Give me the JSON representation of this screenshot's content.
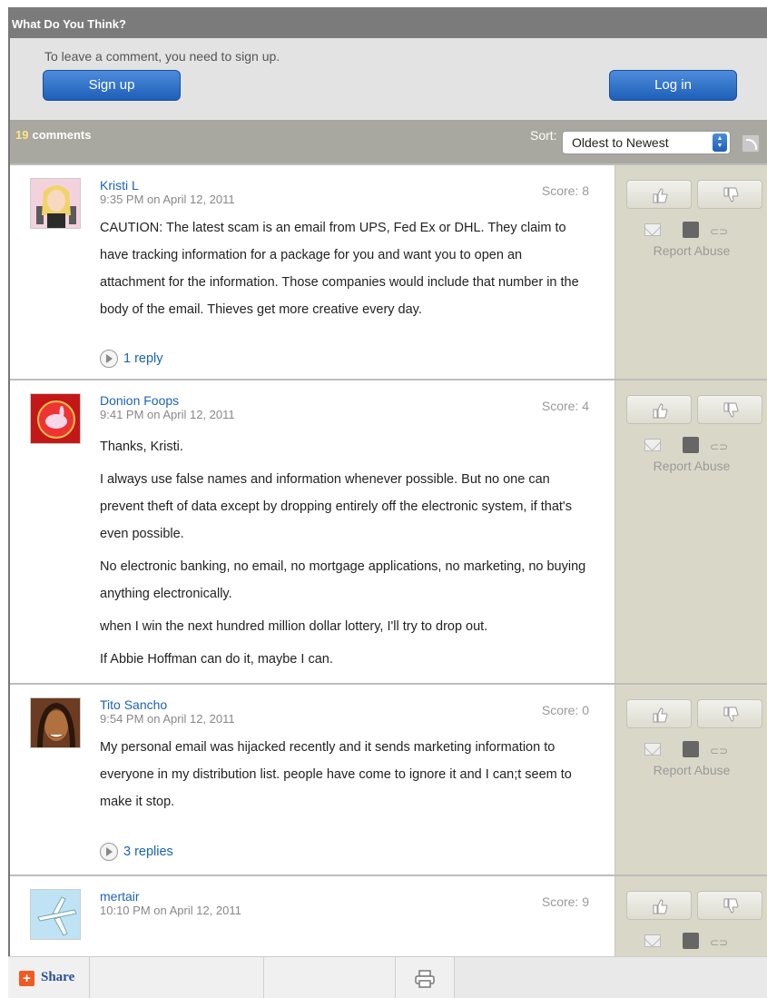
{
  "header": {
    "title": "What Do You Think?"
  },
  "signup": {
    "prompt": "To leave a comment, you need to sign up.",
    "signup_label": "Sign up",
    "login_label": "Log in"
  },
  "comments_bar": {
    "count": "19",
    "count_label": "comments",
    "sort_label": "Sort:",
    "sort_value": "Oldest to Newest"
  },
  "comments": [
    {
      "author": "Kristi L",
      "time": "9:35 PM on April 12, 2011",
      "score": "Score: 8",
      "paragraphs": [
        "CAUTION: The latest scam is an email from UPS, Fed Ex or DHL. They claim to have tracking information for a package for you and want you to open an attachment for the information. Those companies would include that number in the body of the email. Thieves get more creative every day."
      ],
      "replies": "1 reply"
    },
    {
      "author": "Donion Foops",
      "time": "9:41 PM on April 12, 2011",
      "score": "Score: 4",
      "paragraphs": [
        "Thanks, Kristi.",
        "I always use false names and information whenever possible. But no one can prevent theft of data except by dropping entirely off the electronic system, if that's even possible.",
        "No electronic banking, no email, no mortgage applications, no marketing, no buying anything electronically.",
        "when I win the next hundred million dollar lottery, I'll try to drop out.",
        "If Abbie Hoffman can do it, maybe I can."
      ]
    },
    {
      "author": "Tito Sancho",
      "time": "9:54 PM on April 12, 2011",
      "score": "Score: 0",
      "paragraphs": [
        "My personal email was hijacked recently and it sends marketing information to everyone in my distribution list. people have come to ignore it and I can;t seem to make it stop."
      ],
      "replies": "3 replies"
    },
    {
      "author": "mertair",
      "time": "10:10 PM on April 12, 2011",
      "score": "Score: 9"
    }
  ],
  "side": {
    "report_label": "Report Abuse"
  },
  "share_bar": {
    "share_label": "Share"
  },
  "colors": {
    "accent_blue": "#1a63b7",
    "count_yellow": "#ffe680",
    "share_orange": "#f15a22"
  }
}
